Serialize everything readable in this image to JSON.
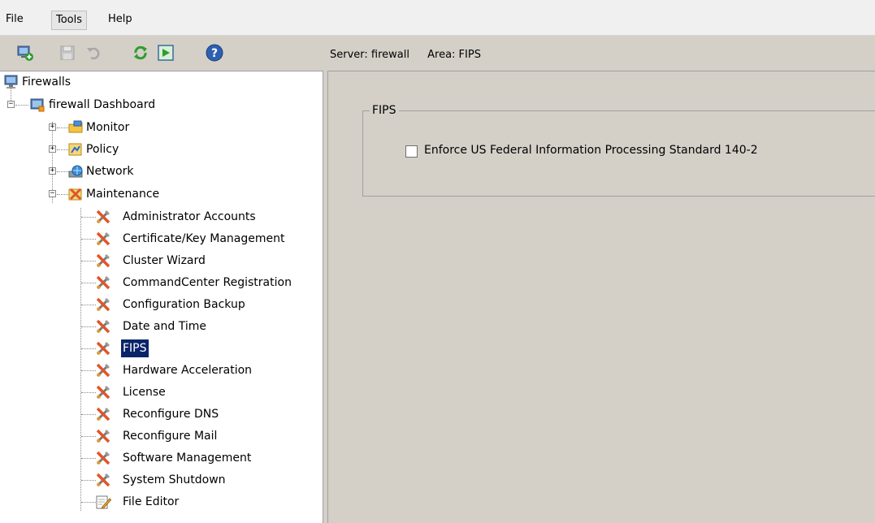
{
  "menu": {
    "items": [
      "File",
      "Tools",
      "Help"
    ]
  },
  "toolbar": {
    "icons": [
      "connect-icon",
      "save-icon",
      "undo-icon",
      "refresh-icon",
      "run-icon",
      "help-icon"
    ],
    "server_label": "Server: firewall",
    "area_label": "Area: FIPS"
  },
  "tree": {
    "root": "Firewalls",
    "dashboard": "firewall Dashboard",
    "top_items": [
      "Monitor",
      "Policy",
      "Network",
      "Maintenance"
    ],
    "maintenance_items": [
      "Administrator Accounts",
      "Certificate/Key Management",
      "Cluster Wizard",
      "CommandCenter Registration",
      "Configuration Backup",
      "Date and Time",
      "FIPS",
      "Hardware Acceleration",
      "License",
      "Reconfigure DNS",
      "Reconfigure Mail",
      "Software Management",
      "System Shutdown",
      "File Editor"
    ],
    "selected": "FIPS"
  },
  "content": {
    "group_title": "FIPS",
    "checkbox_label": "Enforce US Federal Information Processing Standard 140-2",
    "checkbox_checked": false
  },
  "colors": {
    "selection": "#0a246a",
    "panel": "#d4d0c8",
    "tree_bg": "#ffffff"
  }
}
